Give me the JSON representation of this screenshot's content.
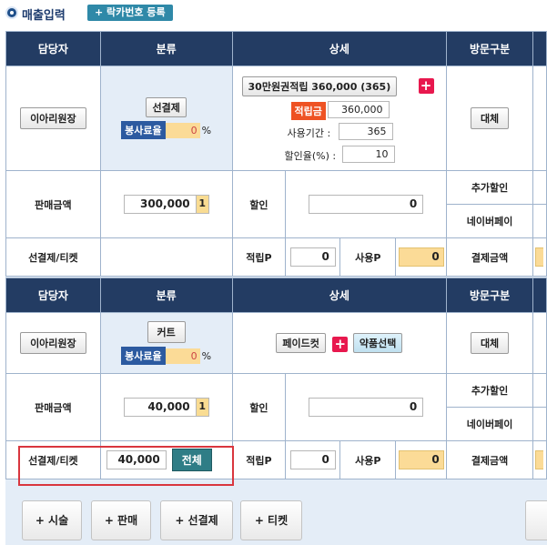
{
  "header": {
    "title": "매출입력",
    "rack_button": "+ 락카번호 등록"
  },
  "columns": [
    "담당자",
    "분류",
    "상세",
    "방문구분"
  ],
  "section1": {
    "staff_button": "이아리원장",
    "category_button": "선결제",
    "service_rate_label": "봉사료율",
    "service_rate_value": "0",
    "pct": "%",
    "product_button": "30만원권적립 360,000 (365)",
    "accum_label": "적립금",
    "accum_value": "360,000",
    "period_label": "사용기간 :",
    "period_value": "365",
    "discount_label": "할인율(%) :",
    "discount_value": "10",
    "visit_button": "대체",
    "sales_label": "판매금액",
    "sales_value": "300,000",
    "sales_qty": "1",
    "discount_text": "할인",
    "discount_amount": "0",
    "extra_discount": "추가할인",
    "naver_pay": "네이버페이",
    "prepay_label": "선결제/티켓",
    "points_label": "적립P",
    "points_value": "0",
    "use_label": "사용P",
    "use_value": "0",
    "payment_label": "결제금액"
  },
  "section2": {
    "staff_button": "이아리원장",
    "category_button": "커트",
    "service_rate_label": "봉사료율",
    "service_rate_value": "0",
    "pct": "%",
    "product_button": "페이드컷",
    "med_button": "약품선택",
    "visit_button": "대체",
    "sales_label": "판매금액",
    "sales_value": "40,000",
    "sales_qty": "1",
    "discount_text": "할인",
    "discount_amount": "0",
    "extra_discount": "추가할인",
    "naver_pay": "네이버페이",
    "prepay_label": "선결제/티켓",
    "prepay_value": "40,000",
    "all_button": "전체",
    "points_label": "적립P",
    "points_value": "0",
    "use_label": "사용P",
    "use_value": "0",
    "payment_label": "결제금액"
  },
  "bottom_buttons": [
    "+ 시술",
    "+ 판매",
    "+ 선결제",
    "+ 티켓"
  ]
}
